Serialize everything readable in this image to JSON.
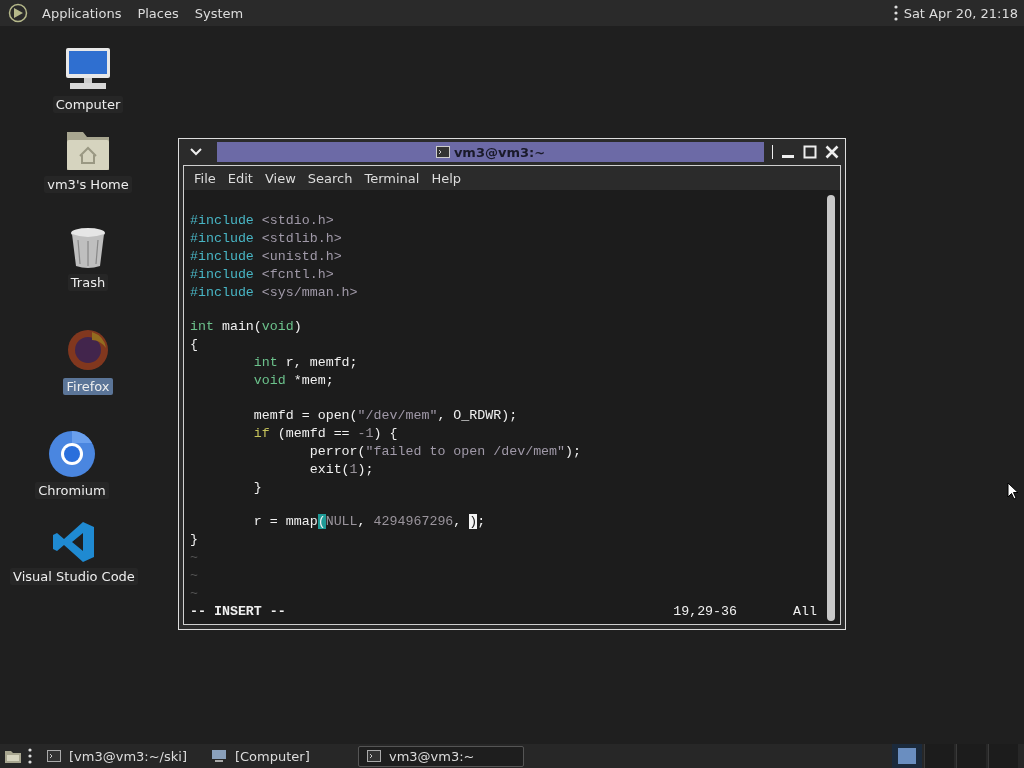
{
  "top_panel": {
    "menus": [
      "Applications",
      "Places",
      "System"
    ],
    "clock": "Sat Apr 20, 21:18"
  },
  "desktop_icons": [
    {
      "kind": "computer",
      "label": "Computer",
      "selected": false
    },
    {
      "kind": "home",
      "label": "vm3's Home",
      "selected": false
    },
    {
      "kind": "trash",
      "label": "Trash",
      "selected": false
    },
    {
      "kind": "firefox",
      "label": "Firefox",
      "selected": true
    },
    {
      "kind": "chromium",
      "label": "Chromium",
      "selected": false
    },
    {
      "kind": "vscode",
      "label": "Visual Studio Code",
      "selected": false
    }
  ],
  "window": {
    "title": "vm3@vm3:~",
    "menu": [
      "File",
      "Edit",
      "View",
      "Search",
      "Terminal",
      "Help"
    ],
    "lines": [
      {
        "kind": "blank"
      },
      {
        "kind": "code",
        "tokens": [
          {
            "text": "#include",
            "kind": "preproc"
          },
          {
            "text": " <stdio.h>",
            "kind": "header"
          }
        ]
      },
      {
        "kind": "code",
        "tokens": [
          {
            "text": "#include",
            "kind": "preproc"
          },
          {
            "text": " <stdlib.h>",
            "kind": "header"
          }
        ]
      },
      {
        "kind": "code",
        "tokens": [
          {
            "text": "#include",
            "kind": "preproc"
          },
          {
            "text": " <unistd.h>",
            "kind": "header"
          }
        ]
      },
      {
        "kind": "code",
        "tokens": [
          {
            "text": "#include",
            "kind": "preproc"
          },
          {
            "text": " <fcntl.h>",
            "kind": "header"
          }
        ]
      },
      {
        "kind": "code",
        "tokens": [
          {
            "text": "#include",
            "kind": "preproc"
          },
          {
            "text": " <sys/mman.h>",
            "kind": "header"
          }
        ]
      },
      {
        "kind": "blank"
      },
      {
        "kind": "code",
        "tokens": [
          {
            "text": "int",
            "kind": "type"
          },
          {
            "text": " main(",
            "kind": "plain"
          },
          {
            "text": "void",
            "kind": "type"
          },
          {
            "text": ")",
            "kind": "plain"
          }
        ]
      },
      {
        "kind": "code",
        "tokens": [
          {
            "text": "{",
            "kind": "plain"
          }
        ]
      },
      {
        "kind": "code",
        "tokens": [
          {
            "text": "        int",
            "kind": "type"
          },
          {
            "text": " r, memfd;",
            "kind": "plain"
          }
        ]
      },
      {
        "kind": "code",
        "tokens": [
          {
            "text": "        void",
            "kind": "type"
          },
          {
            "text": " *mem;",
            "kind": "plain"
          }
        ]
      },
      {
        "kind": "blank"
      },
      {
        "kind": "code",
        "tokens": [
          {
            "text": "        memfd = open(",
            "kind": "plain"
          },
          {
            "text": "\"/dev/mem\"",
            "kind": "string"
          },
          {
            "text": ", O_RDWR);",
            "kind": "plain"
          }
        ]
      },
      {
        "kind": "code",
        "tokens": [
          {
            "text": "        if",
            "kind": "keyword"
          },
          {
            "text": " (memfd == ",
            "kind": "plain"
          },
          {
            "text": "-1",
            "kind": "number"
          },
          {
            "text": ") {",
            "kind": "plain"
          }
        ]
      },
      {
        "kind": "code",
        "tokens": [
          {
            "text": "               perror(",
            "kind": "plain"
          },
          {
            "text": "\"failed to open /dev/mem\"",
            "kind": "string"
          },
          {
            "text": ");",
            "kind": "plain"
          }
        ]
      },
      {
        "kind": "code",
        "tokens": [
          {
            "text": "               exit(",
            "kind": "plain"
          },
          {
            "text": "1",
            "kind": "number"
          },
          {
            "text": ");",
            "kind": "plain"
          }
        ]
      },
      {
        "kind": "code",
        "tokens": [
          {
            "text": "        }",
            "kind": "plain"
          }
        ]
      },
      {
        "kind": "blank"
      },
      {
        "kind": "code",
        "tokens": [
          {
            "text": "        r = mmap",
            "kind": "plain"
          },
          {
            "text": "(",
            "kind": "match"
          },
          {
            "text": "NULL",
            "kind": "number"
          },
          {
            "text": ", ",
            "kind": "plain"
          },
          {
            "text": "4294967296",
            "kind": "number"
          },
          {
            "text": ", ",
            "kind": "plain"
          },
          {
            "text": ")",
            "kind": "cursor"
          },
          {
            "text": ";",
            "kind": "plain"
          }
        ]
      },
      {
        "kind": "code",
        "tokens": [
          {
            "text": "}",
            "kind": "plain"
          }
        ]
      },
      {
        "kind": "tilde",
        "text": "~"
      },
      {
        "kind": "tilde",
        "text": "~"
      },
      {
        "kind": "tilde",
        "text": "~"
      }
    ],
    "status": {
      "mode": "-- INSERT --",
      "position": "19,29-36",
      "scroll": "All"
    }
  },
  "taskbar": {
    "items": [
      {
        "kind": "terminal",
        "label": "[vm3@vm3:~/ski]",
        "selected": false
      },
      {
        "kind": "computer",
        "label": "[Computer]",
        "selected": false
      },
      {
        "kind": "terminal",
        "label": "vm3@vm3:~",
        "selected": true
      }
    ],
    "workspaces": [
      {
        "selected": true
      },
      {
        "selected": false
      },
      {
        "selected": false
      },
      {
        "selected": false
      }
    ]
  }
}
